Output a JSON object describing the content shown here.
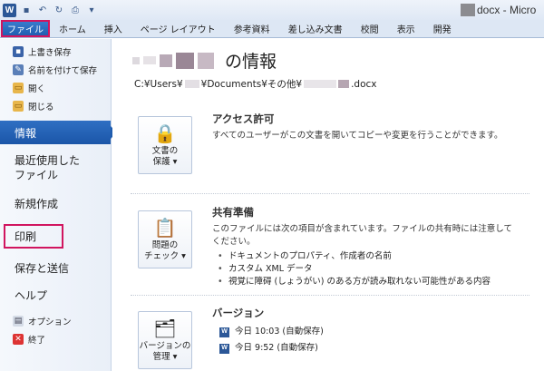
{
  "title_bar": {
    "title": "docx - Micro"
  },
  "ribbon_tabs": [
    "ファイル",
    "ホーム",
    "挿入",
    "ページ レイアウト",
    "参考資料",
    "差し込み文書",
    "校閲",
    "表示",
    "開発"
  ],
  "nav": {
    "save": "上書き保存",
    "save_as": "名前を付けて保存",
    "open": "開く",
    "close": "閉じる",
    "info": "情報",
    "recent_line1": "最近使用した",
    "recent_line2": "ファイル",
    "new": "新規作成",
    "print": "印刷",
    "save_send": "保存と送信",
    "help": "ヘルプ",
    "options": "オプション",
    "exit": "終了"
  },
  "main": {
    "title": "の情報",
    "path_prefix": "C:¥Users¥",
    "path_mid": "¥Documents¥その他¥",
    "path_suffix": ".docx",
    "sections": {
      "permissions": {
        "button_line1": "文書の",
        "button_line2": "保護 ▾",
        "title": "アクセス許可",
        "desc": "すべてのユーザーがこの文書を開いてコピーや変更を行うことができます。"
      },
      "prepare": {
        "button_line1": "問題の",
        "button_line2": "チェック ▾",
        "title": "共有準備",
        "desc": "このファイルには次の項目が含まれています。ファイルの共有時には注意してください。",
        "bullets": [
          "ドキュメントのプロパティ、作成者の名前",
          "カスタム XML データ",
          "視覚に障碍 (しょうがい) のある方が読み取れない可能性がある内容"
        ]
      },
      "versions": {
        "button_line1": "バージョンの",
        "button_line2": "管理 ▾",
        "title": "バージョン",
        "items": [
          "今日 10:03 (自動保存)",
          "今日 9:52 (自動保存)"
        ]
      }
    }
  }
}
